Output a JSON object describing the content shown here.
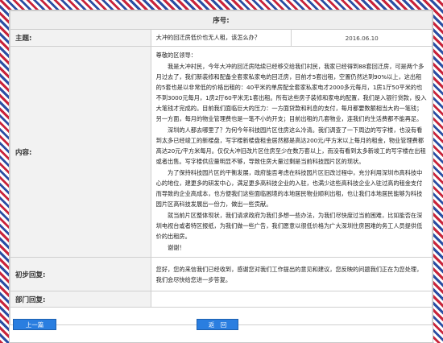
{
  "header": {
    "serial_label": "序号:"
  },
  "subject": {
    "label": "主题:",
    "value": "大冲的回迁房低价也无人租，该怎么办？",
    "date": "2016.06.10"
  },
  "content": {
    "label": "内容:",
    "paragraphs": [
      "尊敬的区领导：",
      "我是大冲村民，今年大冲的回迁房陆续已经移交给我们村民，我家已经得到88套回迁房，可是两个多月过去了，我们新装修和配备全套家私家电的回迁房，目前才5套出租，空置仍然达到90%以上，这出租的5套也是以非常低的价格出租的：40平米的单房配全套家私家电才2000多元每月，1房1厅50平米的也不到3000元每月，1房2厅60平米无1套出租。所有这些房子装修和家电的配置，我们是入银行贷款，投入大笔钱才完成的。目前我们面临巨大的压力：一方面贷款和利息的支付，每月都要数额相当大的一笔钱；另一方面，每月的物业管理费也是一笔不小的开支；目前出租的几套物业，连我们的生活费都不能再足。",
      "深圳的人都去哪里了？为何今年科技园片区住房这么冷清。我们调查了一下周边的写字楼，也没有看到太多已经竣工的新楼盘，写字楼新楼盘租金居然都是高达200元/平方米以上每月的租金，物业管理费都高达20元/平方米每月。仅仅大冲旧改片区住房至少在数万套以上，而没有看到太多新竣工的写字楼在出租或者出售。写字楼供应量明显不够，导致住房大量过剩是当前科技园片区的现状。",
      "为了保持科技园片区的平衡发展，政府能否考虑在科技园片区旧改过程中，充分利用深圳市高科技中心的地位，建更多的研发中心，满足更多高科技企业的入驻，也满少这些高科技企业入驻过高的租金支付而导致的企业高成本，也方便我们这些面临困境的本地居民物业顺利出租，也让我们本地居民能够为科技园片区高科技发展出一份力，做出一些贡献。",
      "就当前片区整体现状，我们请求政府为我们多想一些办法，为我们尽快度过当前困难，比如能否在深圳电视台或者特区报纸，为我们做一些广告，我们愿意以很低价格为广大深圳住房困难的务工人员提供低价的出租房。",
      "谢谢！"
    ]
  },
  "initial_reply": {
    "label": "初步回复:",
    "text": "您好，您的来信我们已经收到，感谢您对我们工作提出的意见和建议，您反映的问题我们正在为您处理，我们会尽快给您进一步答复。"
  },
  "dept_reply": {
    "label": "部门回复:",
    "text": ""
  },
  "buttons": {
    "prev": "上一篇",
    "back": "返　回"
  }
}
